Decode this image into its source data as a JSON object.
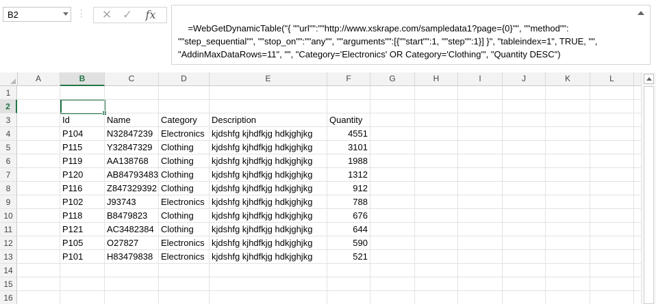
{
  "name_box": {
    "value": "B2"
  },
  "formula_bar": {
    "cancel_icon": "x-icon",
    "enter_icon": "check-icon",
    "fx_label": "fx",
    "formula": "=WebGetDynamicTable(\"{ \"\"url\"\":\"\"http://www.xskrape.com/sampledata1?page={0}\"\", \"\"method\"\": \"\"step_sequential\"\", \"\"stop_on\"\":\"\"any\"\", \"\"arguments\"\":[{\"\"start\"\":1, \"\"step\"\":1}] }\", \"tableindex=1\", TRUE, \"\", \"AddinMaxDataRows=11\", \"\", \"Category='Electronics' OR Category='Clothing'\", \"Quantity DESC\")"
  },
  "columns": [
    "A",
    "B",
    "C",
    "D",
    "E",
    "F",
    "G",
    "H",
    "I",
    "J",
    "K",
    "L"
  ],
  "rows": [
    "1",
    "2",
    "3",
    "4",
    "5",
    "6",
    "7",
    "8",
    "9",
    "10",
    "11",
    "12",
    "13",
    "14",
    "15",
    "16"
  ],
  "selected": {
    "column": "B",
    "row": "2"
  },
  "table": {
    "headers": [
      "Id",
      "Name",
      "Category",
      "Description",
      "Quantity"
    ],
    "data": [
      [
        "P104",
        "N32847239",
        "Electronics",
        "kjdshfg kjhdfkjg hdkjghjkg",
        "4551"
      ],
      [
        "P115",
        "Y32847329",
        "Clothing",
        "kjdshfg kjhdfkjg hdkjghjkg",
        "3101"
      ],
      [
        "P119",
        "AA138768",
        "Clothing",
        "kjdshfg kjhdfkjg hdkjghjkg",
        "1988"
      ],
      [
        "P120",
        "AB84793483",
        "Clothing",
        "kjdshfg kjhdfkjg hdkjghjkg",
        "1312"
      ],
      [
        "P116",
        "Z847329392",
        "Clothing",
        "kjdshfg kjhdfkjg hdkjghjkg",
        "912"
      ],
      [
        "P102",
        "J93743",
        "Electronics",
        "kjdshfg kjhdfkjg hdkjghjkg",
        "788"
      ],
      [
        "P118",
        "B8479823",
        "Clothing",
        "kjdshfg kjhdfkjg hdkjghjkg",
        "676"
      ],
      [
        "P121",
        "AC3482384",
        "Clothing",
        "kjdshfg kjhdfkjg hdkjghjkg",
        "644"
      ],
      [
        "P105",
        "O27827",
        "Electronics",
        "kjdshfg kjhdfkjg hdkjghjkg",
        "590"
      ],
      [
        "P101",
        "H83479838",
        "Electronics",
        "kjdshfg kjhdfkjg hdkjghjkg",
        "521"
      ]
    ]
  },
  "colors": {
    "selection": "#217346",
    "header_bg": "#f3f3f3",
    "gridline": "#e2e2e2"
  }
}
